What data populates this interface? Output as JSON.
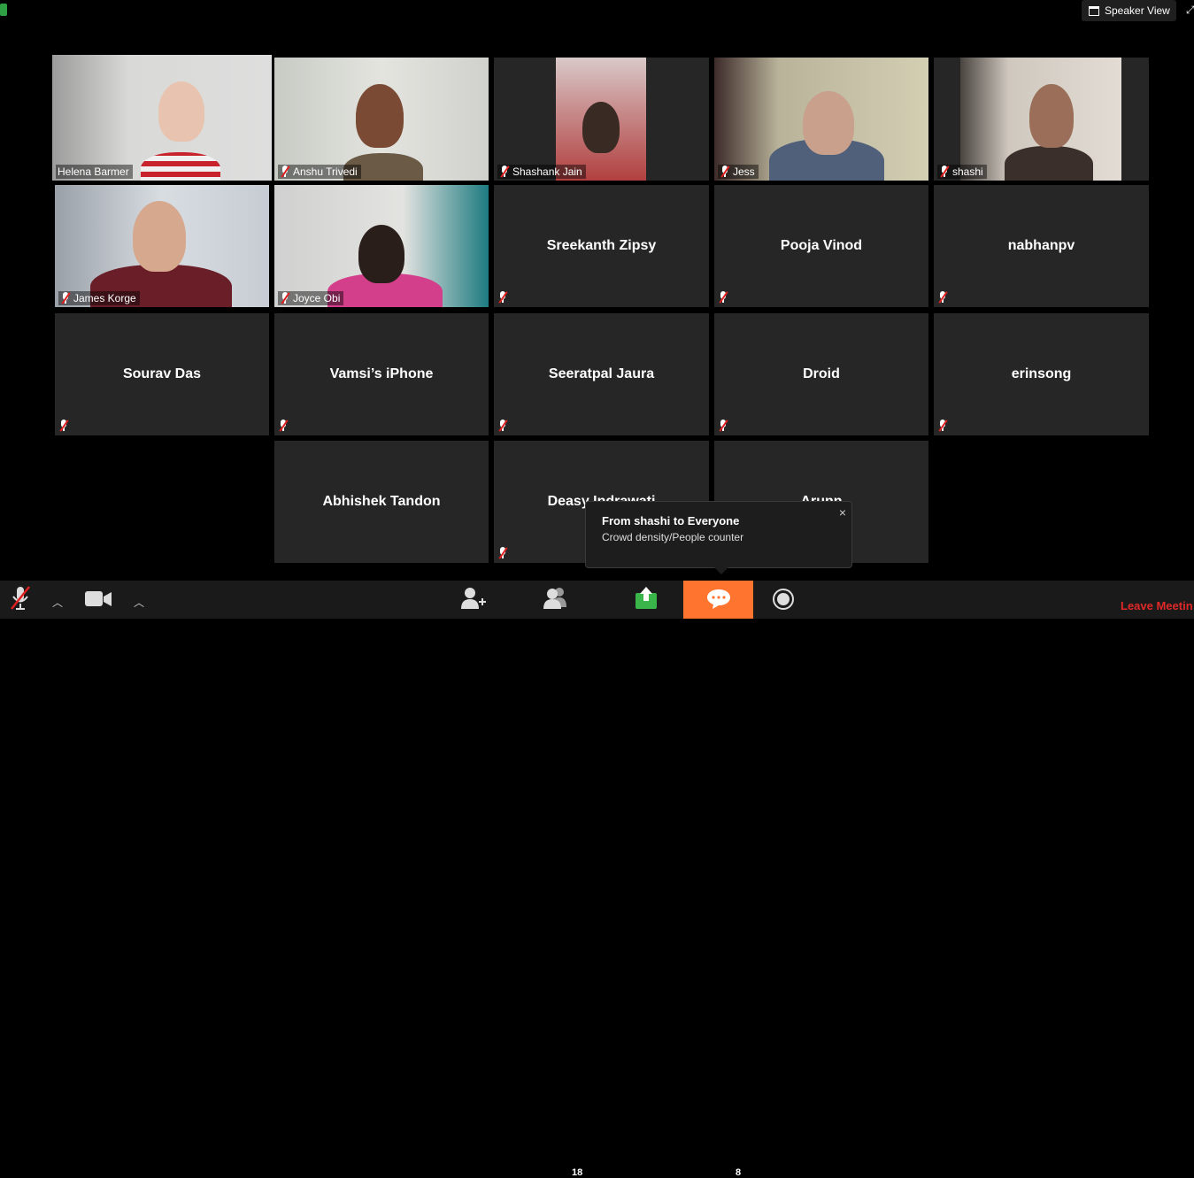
{
  "topbar": {
    "speaker_view_label": "Speaker View"
  },
  "participants": {
    "helena": "Helena Barmer",
    "anshu": "Anshu Trivedi",
    "shashank": "Shashank Jain",
    "jess": "Jess",
    "shashi": "shashi",
    "james": "James Korge",
    "joyce": "Joyce Obi",
    "sreekanth": "Sreekanth Zipsy",
    "pooja": "Pooja Vinod",
    "nabhan": "nabhanpv",
    "sourav": "Sourav Das",
    "vamsi": "Vamsi’s iPhone",
    "seeratpal": "Seeratpal Jaura",
    "droid": "Droid",
    "erin": "erinsong",
    "abhishek": "Abhishek Tandon",
    "deasy": "Deasy Indrawati",
    "arunn": "Arunn"
  },
  "chat_popup": {
    "from": "From shashi to Everyone",
    "message": "Crowd density/People counter",
    "close": "×"
  },
  "toolbar": {
    "participants_count": "18",
    "chat_count": "8",
    "leave_label": "Leave Meetin"
  },
  "icons": [
    "mic-muted-icon",
    "video-camera-icon",
    "invite-icon",
    "participants-icon",
    "share-screen-icon",
    "chat-icon",
    "record-icon",
    "grid-icon",
    "fullscreen-icon",
    "security-shield-icon"
  ],
  "colors": {
    "accent": "#ff742e",
    "active_speaker": "#d8ec6b",
    "leave": "#e02828",
    "muted": "#e02020"
  }
}
